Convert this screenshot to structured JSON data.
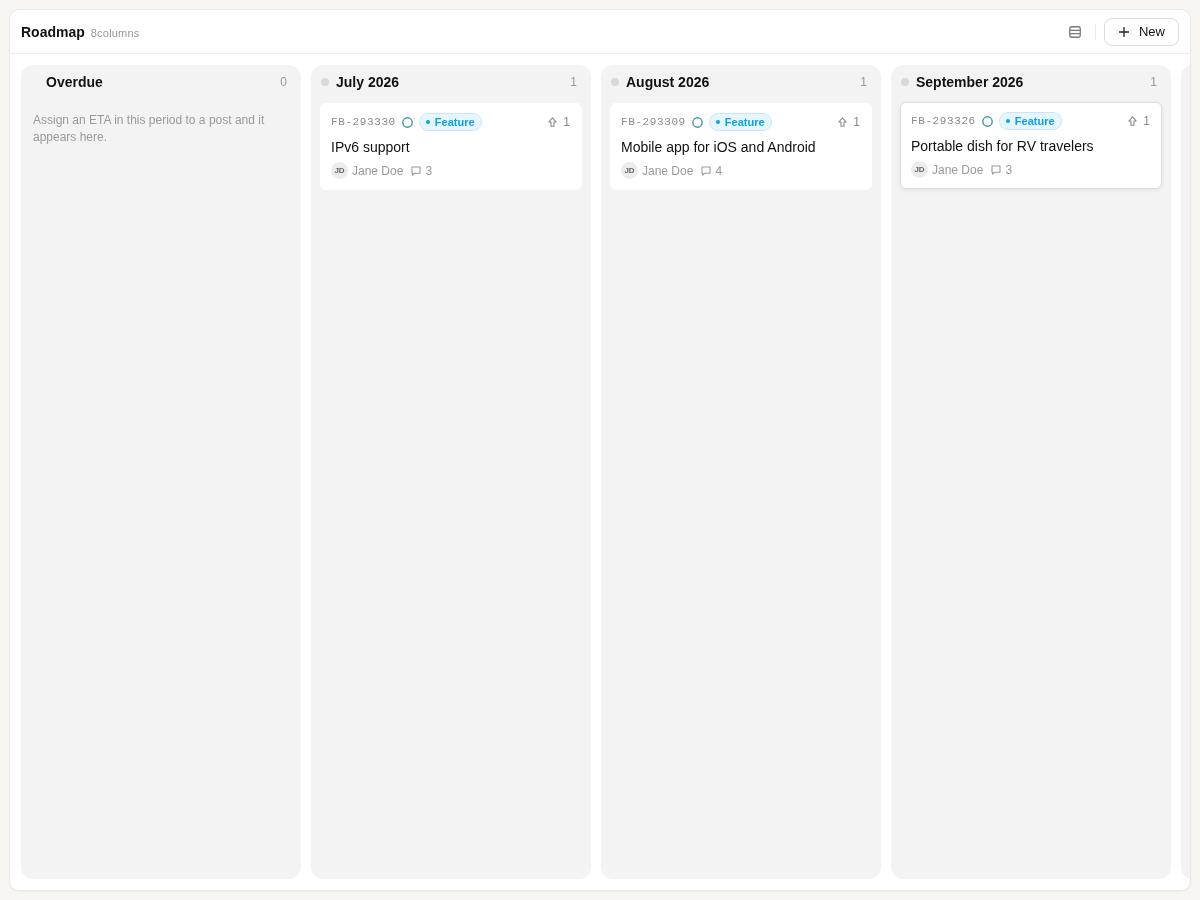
{
  "header": {
    "title": "Roadmap",
    "subtitle": "8columns",
    "new_button": "New"
  },
  "columns": [
    {
      "kind": "period",
      "title": "Overdue",
      "dot": false,
      "count": "0",
      "empty_message": "Assign an ETA in this period to a post and it appears here."
    },
    {
      "kind": "period",
      "title": "July 2026",
      "dot": true,
      "count": "1",
      "cards": [
        {
          "id": "FB-293330",
          "tag": "Feature",
          "votes": "1",
          "title": "IPv6 support",
          "initials": "JD",
          "author": "Jane Doe",
          "comments": "3",
          "hovered": false
        }
      ]
    },
    {
      "kind": "period",
      "title": "August 2026",
      "dot": true,
      "count": "1",
      "cards": [
        {
          "id": "FB-293309",
          "tag": "Feature",
          "votes": "1",
          "title": "Mobile app for iOS and Android",
          "initials": "JD",
          "author": "Jane Doe",
          "comments": "4",
          "hovered": false
        }
      ]
    },
    {
      "kind": "period",
      "title": "September 2026",
      "dot": true,
      "count": "1",
      "cards": [
        {
          "id": "FB-293326",
          "tag": "Feature",
          "votes": "1",
          "title": "Portable dish for RV travelers",
          "initials": "JD",
          "author": "Jane Doe",
          "comments": "3",
          "hovered": true
        }
      ]
    },
    {
      "kind": "clipped"
    }
  ]
}
